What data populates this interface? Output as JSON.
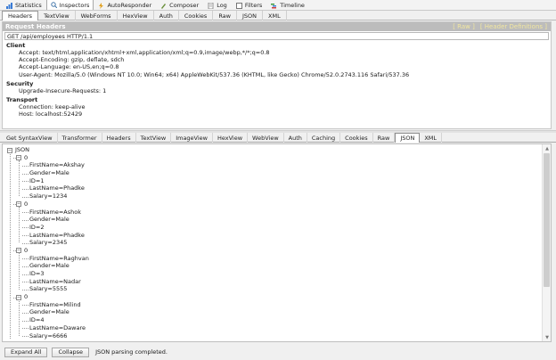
{
  "top_tabs": [
    {
      "label": "Statistics",
      "icon": "statistics-icon"
    },
    {
      "label": "Inspectors",
      "icon": "inspectors-icon",
      "active": true
    },
    {
      "label": "AutoResponder",
      "icon": "autoresponder-icon"
    },
    {
      "label": "Composer",
      "icon": "composer-icon"
    },
    {
      "label": "Log",
      "icon": "log-icon"
    },
    {
      "label": "Filters",
      "icon": "filters-icon"
    },
    {
      "label": "Timeline",
      "icon": "timeline-icon"
    }
  ],
  "request_tabs": [
    "Headers",
    "TextView",
    "WebForms",
    "HexView",
    "Auth",
    "Cookies",
    "Raw",
    "JSON",
    "XML"
  ],
  "request_panel": {
    "title": "Request Headers",
    "raw_link": "[ Raw ]",
    "defs_link": "[ Header Definitions ]",
    "request_line": "GET /api/employees HTTP/1.1",
    "groups": [
      {
        "name": "Client",
        "headers": [
          "Accept: text/html,application/xhtml+xml,application/xml;q=0.9,image/webp,*/*;q=0.8",
          "Accept-Encoding: gzip, deflate, sdch",
          "Accept-Language: en-US,en;q=0.8",
          "User-Agent: Mozilla/5.0 (Windows NT 10.0; Win64; x64) AppleWebKit/537.36 (KHTML, like Gecko) Chrome/52.0.2743.116 Safari/537.36"
        ]
      },
      {
        "name": "Security",
        "headers": [
          "Upgrade-Insecure-Requests: 1"
        ]
      },
      {
        "name": "Transport",
        "headers": [
          "Connection: keep-alive",
          "Host: localhost:52429"
        ]
      }
    ]
  },
  "response_tabs": [
    "Get SyntaxView",
    "Transformer",
    "Headers",
    "TextView",
    "ImageView",
    "HexView",
    "WebView",
    "Auth",
    "Caching",
    "Cookies",
    "Raw",
    "JSON",
    "XML"
  ],
  "response_active": "JSON",
  "json_tree": {
    "root": "JSON",
    "items": [
      {
        "index": "0",
        "fields": [
          "FirstName=Akshay",
          "Gender=Male",
          "ID=1",
          "LastName=Phadke",
          "Salary=1234"
        ]
      },
      {
        "index": "0",
        "fields": [
          "FirstName=Ashok",
          "Gender=Male",
          "ID=2",
          "LastName=Phadke",
          "Salary=2345"
        ]
      },
      {
        "index": "0",
        "fields": [
          "FirstName=Raghvan",
          "Gender=Male",
          "ID=3",
          "LastName=Nadar",
          "Salary=5555"
        ]
      },
      {
        "index": "0",
        "fields": [
          "FirstName=Milind",
          "Gender=Male",
          "ID=4",
          "LastName=Daware",
          "Salary=6666"
        ]
      }
    ]
  },
  "bottom": {
    "expand_label": "Expand All",
    "collapse_label": "Collapse",
    "status": "JSON parsing completed."
  },
  "colors": {
    "header_bar": "#bcbcbc",
    "link": "#f2e7a0",
    "panel_bg": "#ffffff"
  }
}
